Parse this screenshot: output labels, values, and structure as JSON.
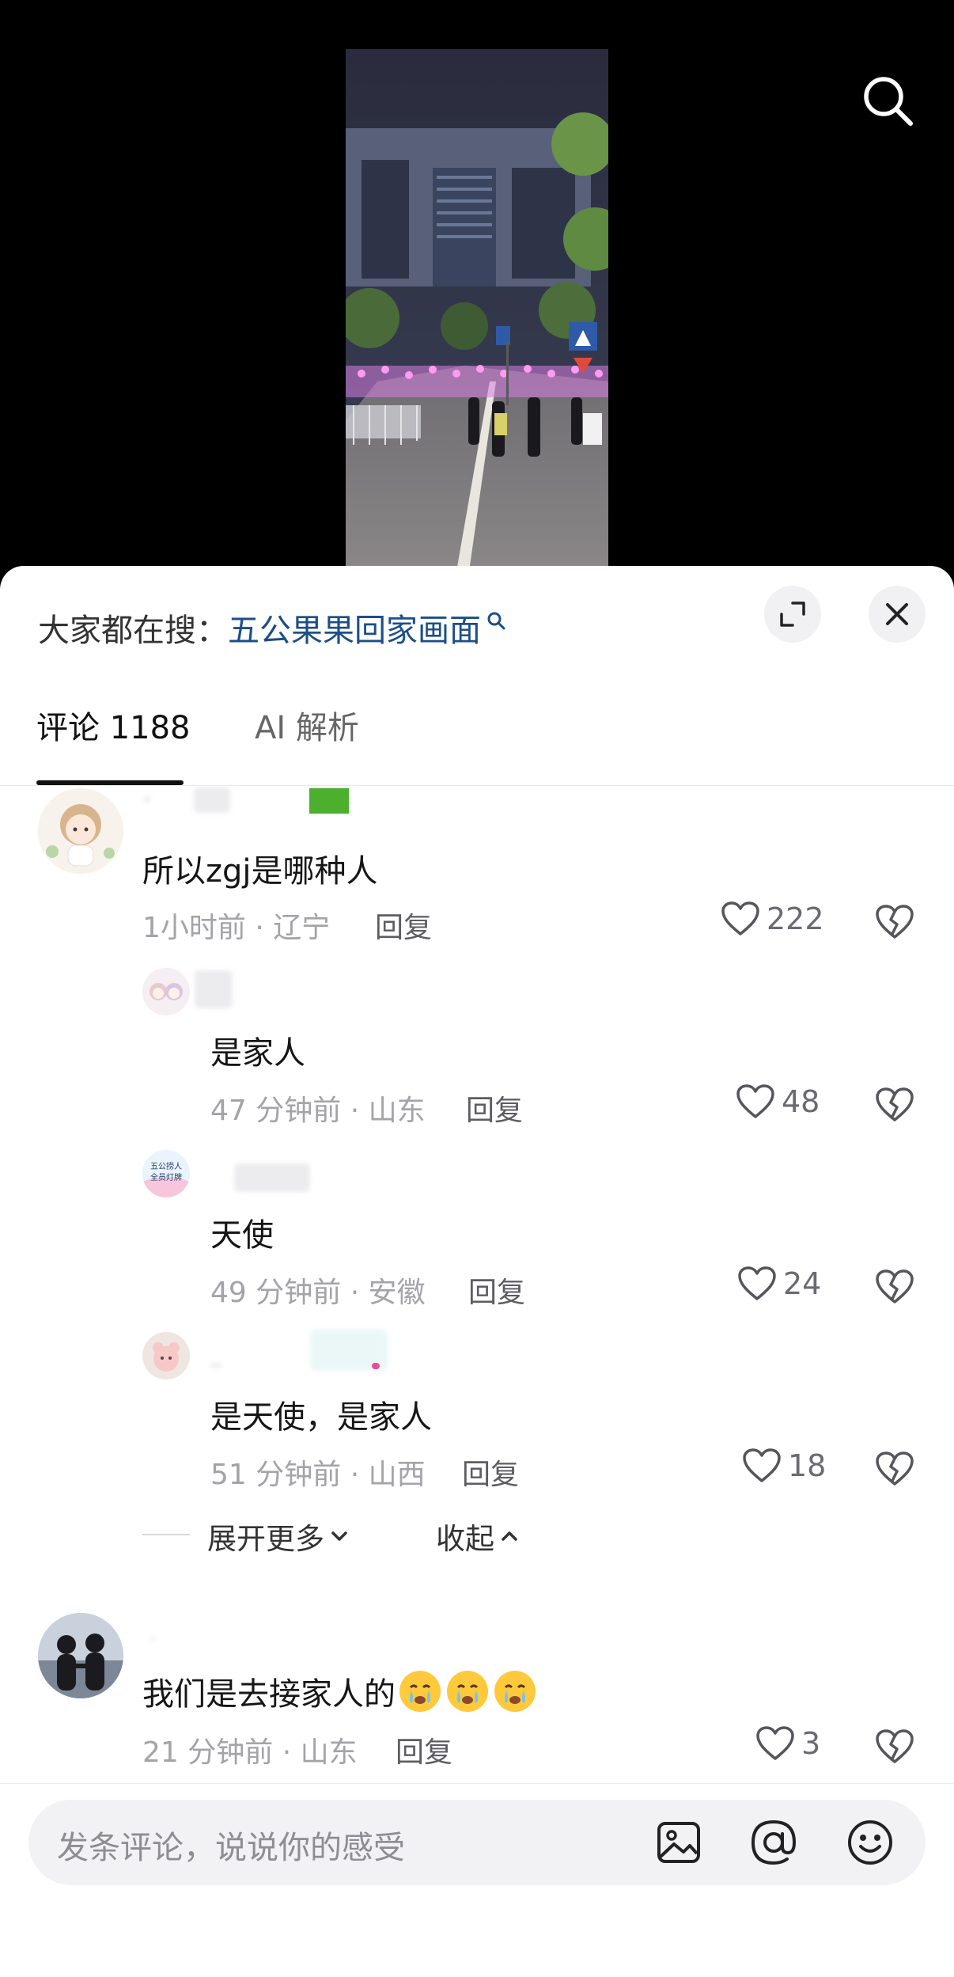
{
  "hot_search": {
    "prefix": "大家都在搜：",
    "term": "五公果果回家画面"
  },
  "tabs": [
    {
      "label": "评论 1188",
      "active": true
    },
    {
      "label": "AI 解析",
      "active": false
    }
  ],
  "comments": [
    {
      "text": "所以zgj是哪种人",
      "time": "1小时前 · 辽宁",
      "reply_label": "回复",
      "likes": "222",
      "replies": [
        {
          "text": "是家人",
          "time": "47 分钟前 · 山东",
          "reply_label": "回复",
          "likes": "48"
        },
        {
          "text": "天使",
          "time": "49 分钟前 · 安徽",
          "reply_label": "回复",
          "likes": "24",
          "avatar_text": "五公捞人\n全员灯牌"
        },
        {
          "text": "是天使，是家人",
          "time": "51 分钟前 · 山西",
          "reply_label": "回复",
          "likes": "18"
        }
      ],
      "expand_more_label": "展开更多",
      "collapse_label": "收起"
    },
    {
      "text": "我们是去接家人的",
      "time": "21 分钟前 · 山东",
      "reply_label": "回复",
      "likes": "3"
    }
  ],
  "input": {
    "placeholder": "发条评论，说说你的感受"
  },
  "icons": {
    "search": "search-icon",
    "expand": "expand-icon",
    "close": "close-icon",
    "like": "heart-icon",
    "dislike": "broken-heart-icon",
    "image": "image-icon",
    "mention": "at-icon",
    "emoji": "emoji-icon"
  },
  "colors": {
    "hot_term": "#1d4e89",
    "sheet_bg": "#ffffff",
    "input_bg": "#f2f2f4"
  }
}
